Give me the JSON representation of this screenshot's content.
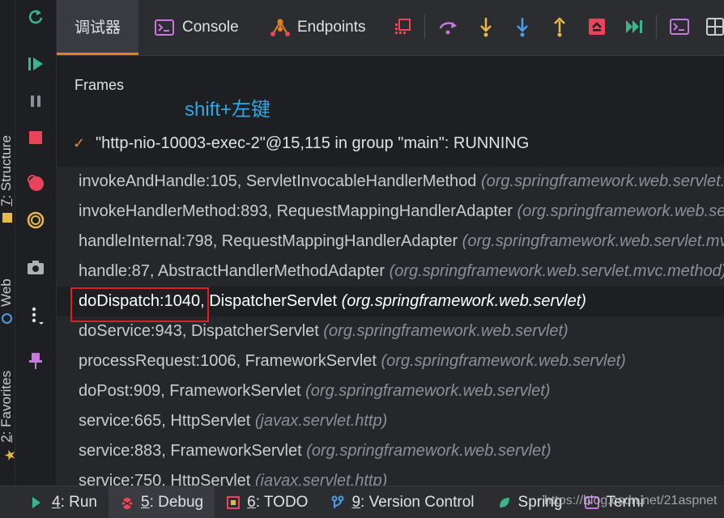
{
  "tabs": [
    {
      "label": "调试器",
      "icon": "debugger-tab",
      "active": true
    },
    {
      "label": "Console",
      "icon": "console-icon"
    },
    {
      "label": "Endpoints",
      "icon": "endpoints-icon"
    }
  ],
  "toolbar_icons": [
    "frames-layout-icon",
    "step-over-icon",
    "step-into-icon",
    "force-step-into-icon",
    "step-out-icon",
    "drop-frame-icon",
    "run-to-cursor-icon",
    "evaluate-expression-icon"
  ],
  "side_icons": [
    "rerun-icon",
    "resume-icon",
    "pause-icon",
    "stop-icon",
    "view-breakpoints-icon",
    "mute-breakpoints-icon",
    "camera-icon",
    "more-icon",
    "pin-icon"
  ],
  "left_tabs": {
    "structure": "Structure",
    "structure_num": "7",
    "web": "Web",
    "favorites": "Favorites",
    "favorites_num": "2"
  },
  "frames_title": "Frames",
  "annotation": "shift+左键",
  "thread": "\"http-nio-10003-exec-2\"@15,115 in group \"main\": RUNNING",
  "frames": [
    {
      "method": "invokeAndHandle:105, ServletInvocableHandlerMethod ",
      "pkg": "(org.springframework.web.servlet.mvc.method.annotation)"
    },
    {
      "method": "invokeHandlerMethod:893, RequestMappingHandlerAdapter ",
      "pkg": "(org.springframework.web.servlet.mvc.method.annotation)"
    },
    {
      "method": "handleInternal:798, RequestMappingHandlerAdapter ",
      "pkg": "(org.springframework.web.servlet.mvc.method.annotation)"
    },
    {
      "method": "handle:87, AbstractHandlerMethodAdapter ",
      "pkg": "(org.springframework.web.servlet.mvc.method)"
    },
    {
      "method": "doDispatch:1040, DispatcherServlet ",
      "pkg": "(org.springframework.web.servlet)",
      "selected": true
    },
    {
      "method": "doService:943, DispatcherServlet ",
      "pkg": "(org.springframework.web.servlet)"
    },
    {
      "method": "processRequest:1006, FrameworkServlet ",
      "pkg": "(org.springframework.web.servlet)"
    },
    {
      "method": "doPost:909, FrameworkServlet ",
      "pkg": "(org.springframework.web.servlet)"
    },
    {
      "method": "service:665, HttpServlet ",
      "pkg": "(javax.servlet.http)"
    },
    {
      "method": "service:883, FrameworkServlet ",
      "pkg": "(org.springframework.web.servlet)"
    },
    {
      "method": "service:750, HttpServlet ",
      "pkg": "(javax.servlet.http)"
    }
  ],
  "bottom_tabs": [
    {
      "num": "4",
      "label": ": Run",
      "icon": "run-icon"
    },
    {
      "num": "5",
      "label": ": Debug",
      "icon": "debug-icon",
      "active": true
    },
    {
      "num": "6",
      "label": ": TODO",
      "icon": "todo-icon"
    },
    {
      "num": "9",
      "label": ": Version Control",
      "icon": "version-control-icon"
    },
    {
      "num": "",
      "label": "Spring",
      "icon": "spring-icon"
    },
    {
      "num": "",
      "label": "Termi",
      "icon": "terminal-icon"
    }
  ],
  "watermark": "https://blog.csdn.net/21aspnet",
  "colors": {
    "accent_tab": "#e67e22",
    "highlight_box": "#e02020",
    "annotation": "#2ea9e8"
  }
}
